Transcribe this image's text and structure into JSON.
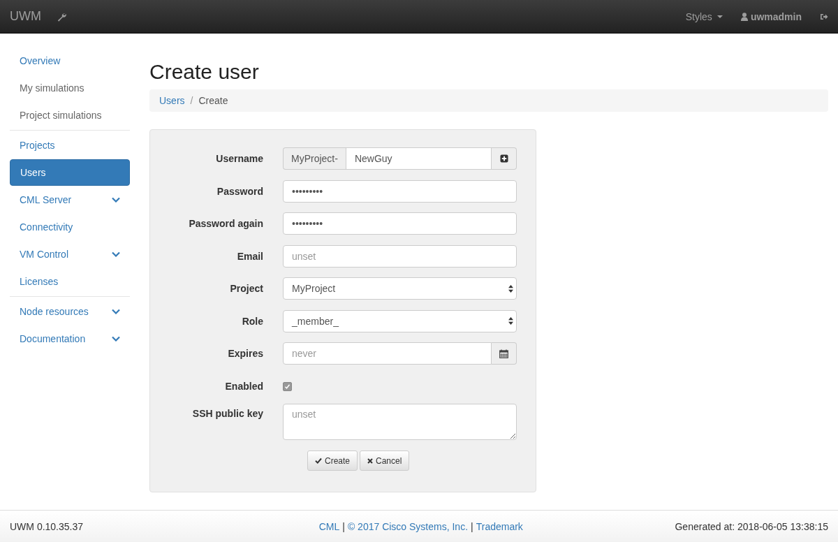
{
  "navbar": {
    "brand": "UWM",
    "styles_menu": "Styles",
    "user": "uwmadmin"
  },
  "sidebar": {
    "groups": [
      {
        "items": [
          {
            "label": "Overview",
            "selected": false,
            "expandable": false,
            "disabled": false
          },
          {
            "label": "My simulations",
            "selected": false,
            "expandable": false,
            "disabled": true
          },
          {
            "label": "Project simulations",
            "selected": false,
            "expandable": false,
            "disabled": true
          }
        ]
      },
      {
        "items": [
          {
            "label": "Projects",
            "selected": false,
            "expandable": false
          },
          {
            "label": "Users",
            "selected": true,
            "expandable": false
          },
          {
            "label": "CML Server",
            "selected": false,
            "expandable": true
          },
          {
            "label": "Connectivity",
            "selected": false,
            "expandable": false
          },
          {
            "label": "VM Control",
            "selected": false,
            "expandable": true
          },
          {
            "label": "Licenses",
            "selected": false,
            "expandable": false
          }
        ]
      },
      {
        "items": [
          {
            "label": "Node resources",
            "selected": false,
            "expandable": true
          },
          {
            "label": "Documentation",
            "selected": false,
            "expandable": true
          }
        ]
      }
    ]
  },
  "page": {
    "title": "Create user",
    "breadcrumb": [
      {
        "label": "Users",
        "link": true
      },
      {
        "label": "Create",
        "link": false
      }
    ],
    "breadcrumb_separator": "/"
  },
  "form": {
    "fields": [
      {
        "kind": "prefixed",
        "label": "Username",
        "prefix": "MyProject-",
        "value": "NewGuy"
      },
      {
        "kind": "text",
        "label": "Password",
        "value": "•••••••••"
      },
      {
        "kind": "text",
        "label": "Password again",
        "value": "•••••••••"
      },
      {
        "kind": "text",
        "label": "Email",
        "placeholder": "unset"
      },
      {
        "kind": "select",
        "label": "Project",
        "value": "MyProject"
      },
      {
        "kind": "select",
        "label": "Role",
        "value": "_member_"
      },
      {
        "kind": "date",
        "label": "Expires",
        "placeholder": "never"
      },
      {
        "kind": "checkbox",
        "label": "Enabled",
        "checked": true,
        "disabled": true
      },
      {
        "kind": "textarea",
        "label": "SSH public key",
        "placeholder": "unset"
      }
    ],
    "buttons": [
      {
        "kind": "create",
        "label": "Create"
      },
      {
        "kind": "cancel",
        "label": "Cancel"
      }
    ]
  },
  "footer": {
    "version": "UWM 0.10.35.37",
    "center": [
      {
        "kind": "link",
        "text": "CML"
      },
      {
        "kind": "separator",
        "text": "|"
      },
      {
        "kind": "link",
        "text": "© 2017 Cisco Systems, Inc."
      },
      {
        "kind": "separator",
        "text": "|"
      },
      {
        "kind": "link",
        "text": "Trademark"
      }
    ],
    "generated": "Generated at: 2018-06-05 13:38:15"
  }
}
